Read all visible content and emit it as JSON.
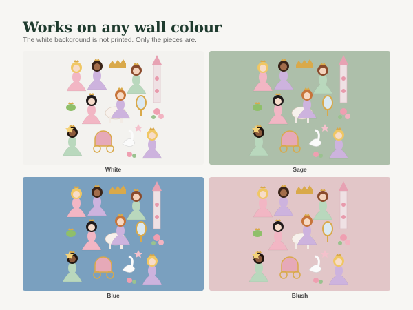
{
  "header": {
    "title": "Works on any wall colour",
    "subtitle": "The white background is not printed. Only the pieces are."
  },
  "panels": [
    {
      "label": "White",
      "color": "#f3f2ef"
    },
    {
      "label": "Sage",
      "color": "#adbfaa"
    },
    {
      "label": "Blue",
      "color": "#7aa0bf"
    },
    {
      "label": "Blush",
      "color": "#e2c6c8"
    }
  ],
  "colors": {
    "title": "#1f3b2e",
    "pink_gown": "#f2b6c4",
    "lilac_gown": "#cdb3de",
    "mint_gown": "#b9d8bd",
    "gold": "#d9a94a"
  }
}
